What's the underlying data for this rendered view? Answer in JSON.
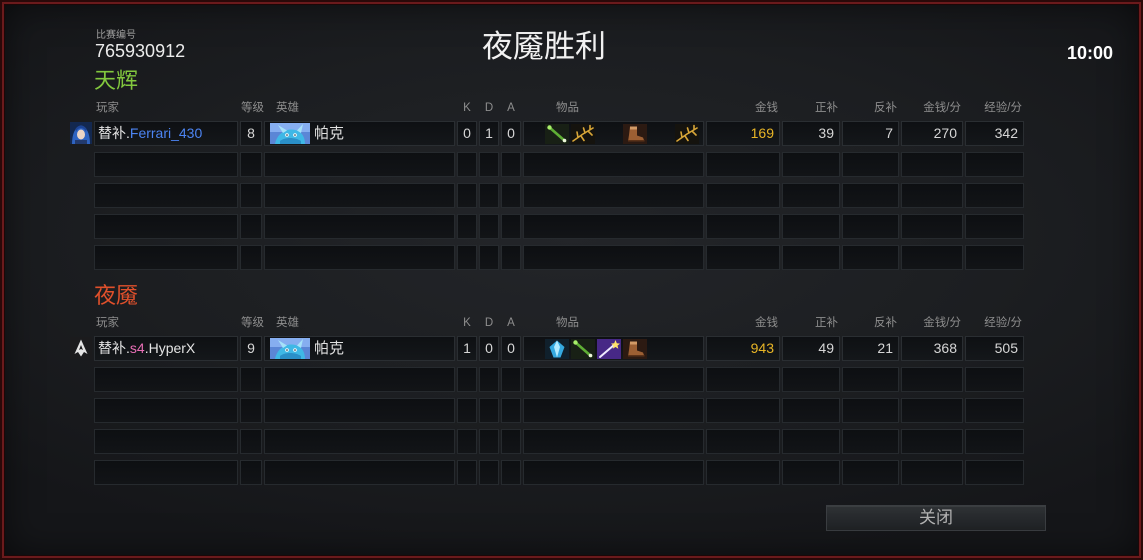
{
  "match": {
    "id_label": "比赛编号",
    "id": "765930912",
    "result_title": "夜魇胜利",
    "duration": "10:00"
  },
  "columns": {
    "player": "玩家",
    "level": "等级",
    "hero": "英雄",
    "kills": "K",
    "deaths": "D",
    "assists": "A",
    "items": "物品",
    "gold": "金钱",
    "last_hits": "正补",
    "denies": "反补",
    "gold_per_min": "金钱/分",
    "xp_per_min": "经验/分"
  },
  "teams": [
    {
      "name": "天辉",
      "color": "#82c83e",
      "players": [
        {
          "avatar_icon": "blue-haired-portrait-avatar-icon",
          "name_parts": [
            {
              "text": "替补.",
              "color": "#e4e4e4"
            },
            {
              "text": "Ferrari_430",
              "color": "#4c84f2"
            }
          ],
          "level": 8,
          "hero_icon": "puck-hero-icon",
          "hero": "帕克",
          "kills": 0,
          "deaths": 1,
          "assists": 0,
          "items": [
            "green-stick-item-icon",
            "golden-branch-item-icon",
            null,
            "boots-item-icon",
            null,
            "golden-branch-item-icon"
          ],
          "gold": 169,
          "last_hits": 39,
          "denies": 7,
          "gold_per_min": 270,
          "xp_per_min": 342
        },
        null,
        null,
        null,
        null
      ]
    },
    {
      "name": "夜魇",
      "color": "#e0502b",
      "players": [
        {
          "avatar_icon": "white-emblem-avatar-icon",
          "name_parts": [
            {
              "text": "替补.",
              "color": "#e4e4e4"
            },
            {
              "text": "s4",
              "color": "#e96fb6"
            },
            {
              "text": ".HyperX",
              "color": "#e4e4e4"
            }
          ],
          "level": 9,
          "hero_icon": "puck-hero-icon",
          "hero": "帕克",
          "kills": 1,
          "deaths": 0,
          "assists": 0,
          "items": [
            "blue-crystal-item-icon",
            "green-stick-item-icon",
            "purple-wand-item-icon",
            "boots-item-icon",
            null,
            null
          ],
          "gold": 943,
          "last_hits": 49,
          "denies": 21,
          "gold_per_min": 368,
          "xp_per_min": 505
        },
        null,
        null,
        null,
        null
      ]
    }
  ],
  "close_button": {
    "label": "关闭"
  },
  "colors": {
    "gold_value": "#e8b526"
  }
}
